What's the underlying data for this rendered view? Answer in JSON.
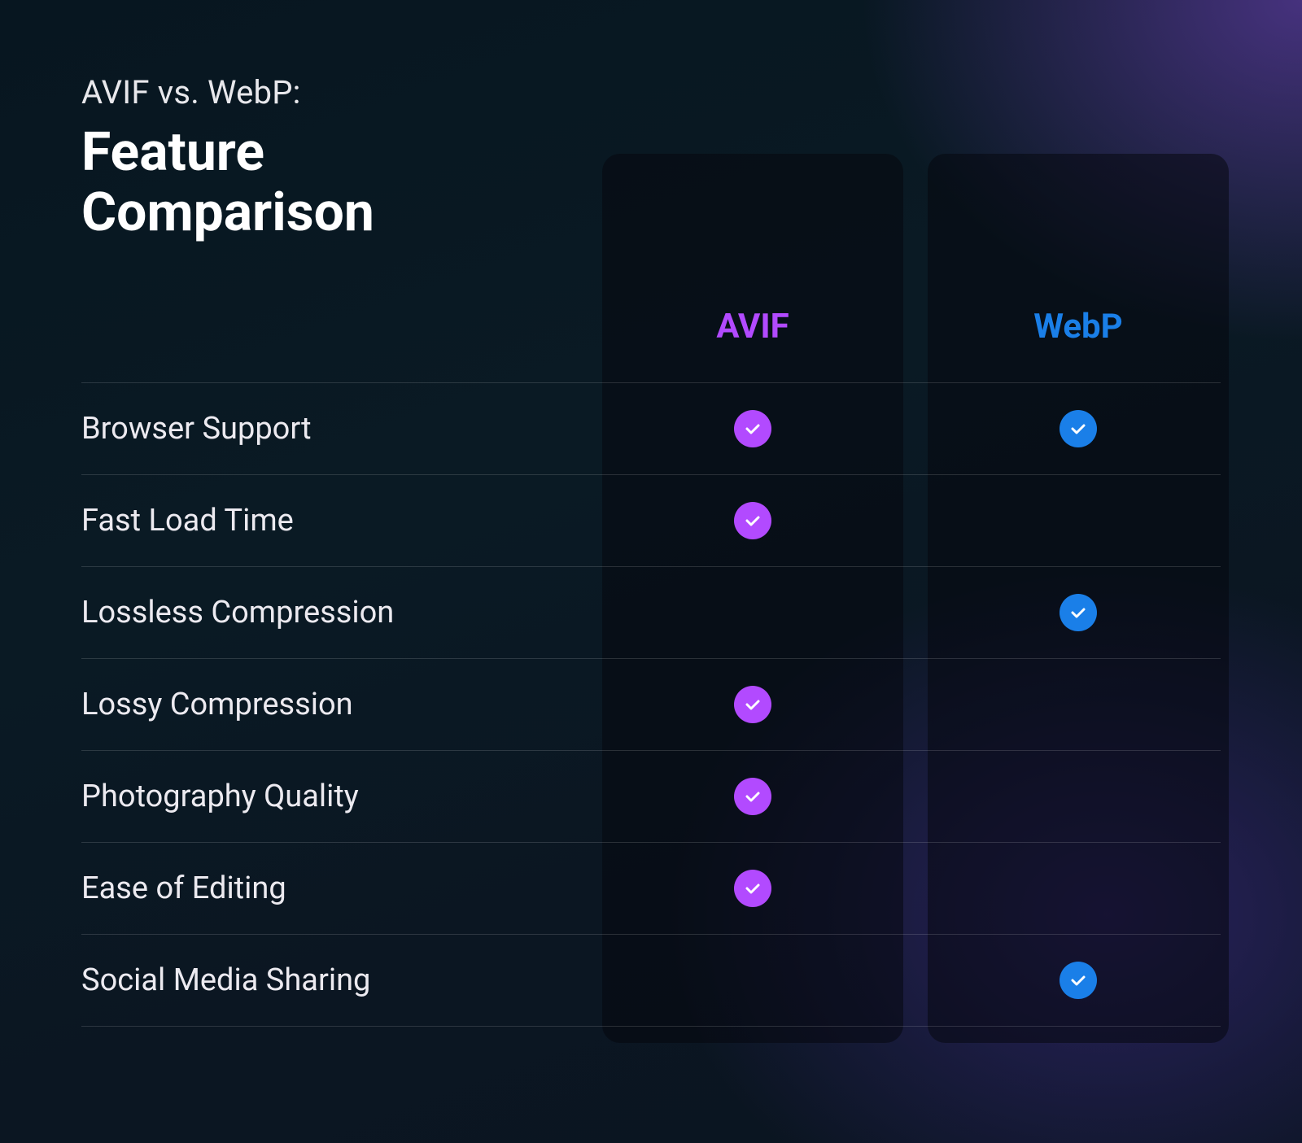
{
  "heading": {
    "subtitle": "AVIF vs. WebP:",
    "title": "Feature Comparison"
  },
  "columns": {
    "avif": {
      "label": "AVIF",
      "color": "#b24aff"
    },
    "webp": {
      "label": "WebP",
      "color": "#1a7fe8"
    }
  },
  "features": [
    {
      "label": "Browser Support",
      "avif": true,
      "webp": true
    },
    {
      "label": "Fast Load Time",
      "avif": true,
      "webp": false
    },
    {
      "label": "Lossless Compression",
      "avif": false,
      "webp": true
    },
    {
      "label": "Lossy Compression",
      "avif": true,
      "webp": false
    },
    {
      "label": "Photography Quality",
      "avif": true,
      "webp": false
    },
    {
      "label": "Ease of Editing",
      "avif": true,
      "webp": false
    },
    {
      "label": "Social Media Sharing",
      "avif": false,
      "webp": true
    }
  ]
}
